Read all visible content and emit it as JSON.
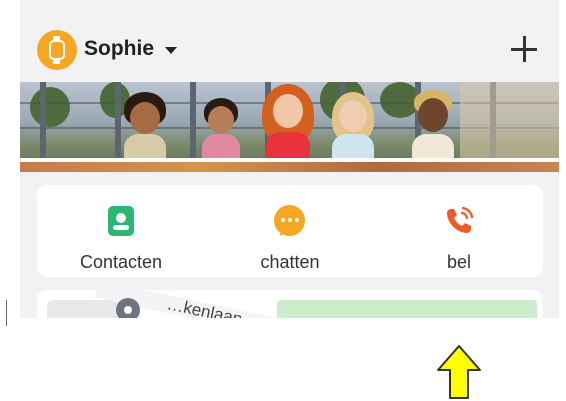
{
  "header": {
    "user_name": "Sophie",
    "avatar_icon": "smartwatch-icon",
    "caret_icon": "caret-down-icon",
    "add_icon": "plus-icon"
  },
  "banner": {
    "image": "children-group-photo"
  },
  "actions": [
    {
      "label": "Contacten",
      "icon": "contacts-book-icon",
      "color": "#2bb673"
    },
    {
      "label": "chatten",
      "icon": "chat-bubble-icon",
      "color": "#f5a623"
    },
    {
      "label": "bel",
      "icon": "phone-ringing-icon",
      "color": "#f05a28"
    }
  ],
  "map": {
    "street_label": "…kenlaan",
    "pin_icon": "location-pin-icon"
  },
  "overlay": {
    "arrow_icon": "up-arrow-icon",
    "arrow_color": "#ffff00"
  },
  "colors": {
    "accent_orange": "#f5a623",
    "background": "#f2f2f4",
    "card": "#ffffff"
  }
}
